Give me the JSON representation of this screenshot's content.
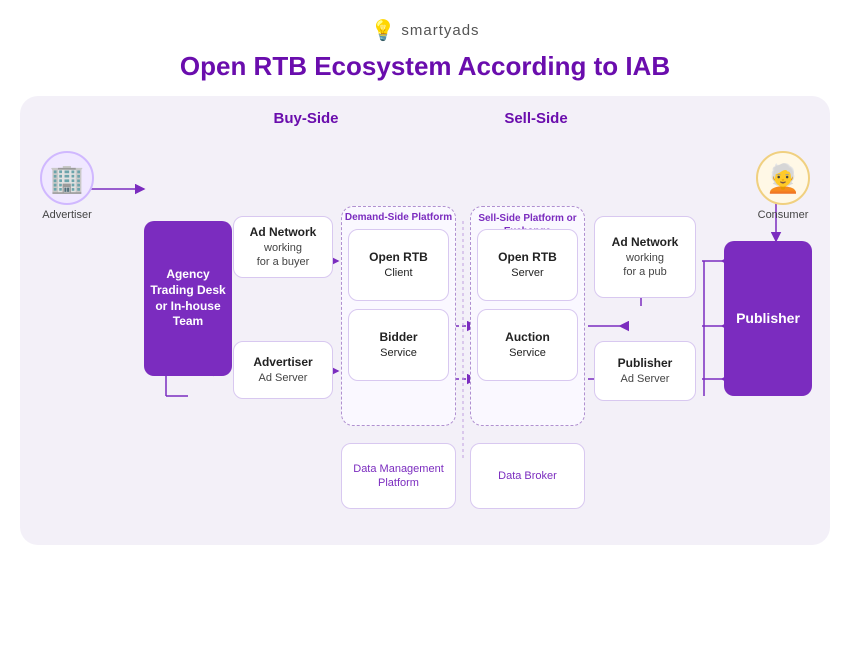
{
  "logo": {
    "icon": "💡",
    "text": "smartyads"
  },
  "title": "Open RTB Ecosystem According to IAB",
  "labels": {
    "buy_side": "Buy-Side",
    "sell_side": "Sell-Side",
    "advertiser": "Advertiser",
    "consumer": "Consumer"
  },
  "nodes": {
    "agency": "Agency\nTrading Desk\nor In-house\nTeam",
    "ad_network_buy": "Ad Network\nworking\nfor a buyer",
    "advertiser_ad_server": "Advertiser\nAd Server",
    "dsp_label": "Demand-Side\nPlatform",
    "open_rtb_client": "Open RTB\nClient",
    "bidder_service": "Bidder\nService",
    "dmp_buy": "Data\nManagement\nPlatform",
    "ssp_label": "Sell-Side\nPlatform\nor Exchange",
    "open_rtb_server": "Open RTB\nServer",
    "auction_service": "Auction\nService",
    "data_broker": "Data Broker",
    "ad_network_sell": "Ad Network\nworking\nfor a pub",
    "publisher_ad_server": "Publisher\nAd Server",
    "publisher": "Publisher"
  },
  "colors": {
    "purple": "#7b2cbf",
    "light_purple": "#f3f0f8",
    "border": "#d8c8f0",
    "dashed": "#b090d0",
    "text_purple": "#6a0dad"
  }
}
